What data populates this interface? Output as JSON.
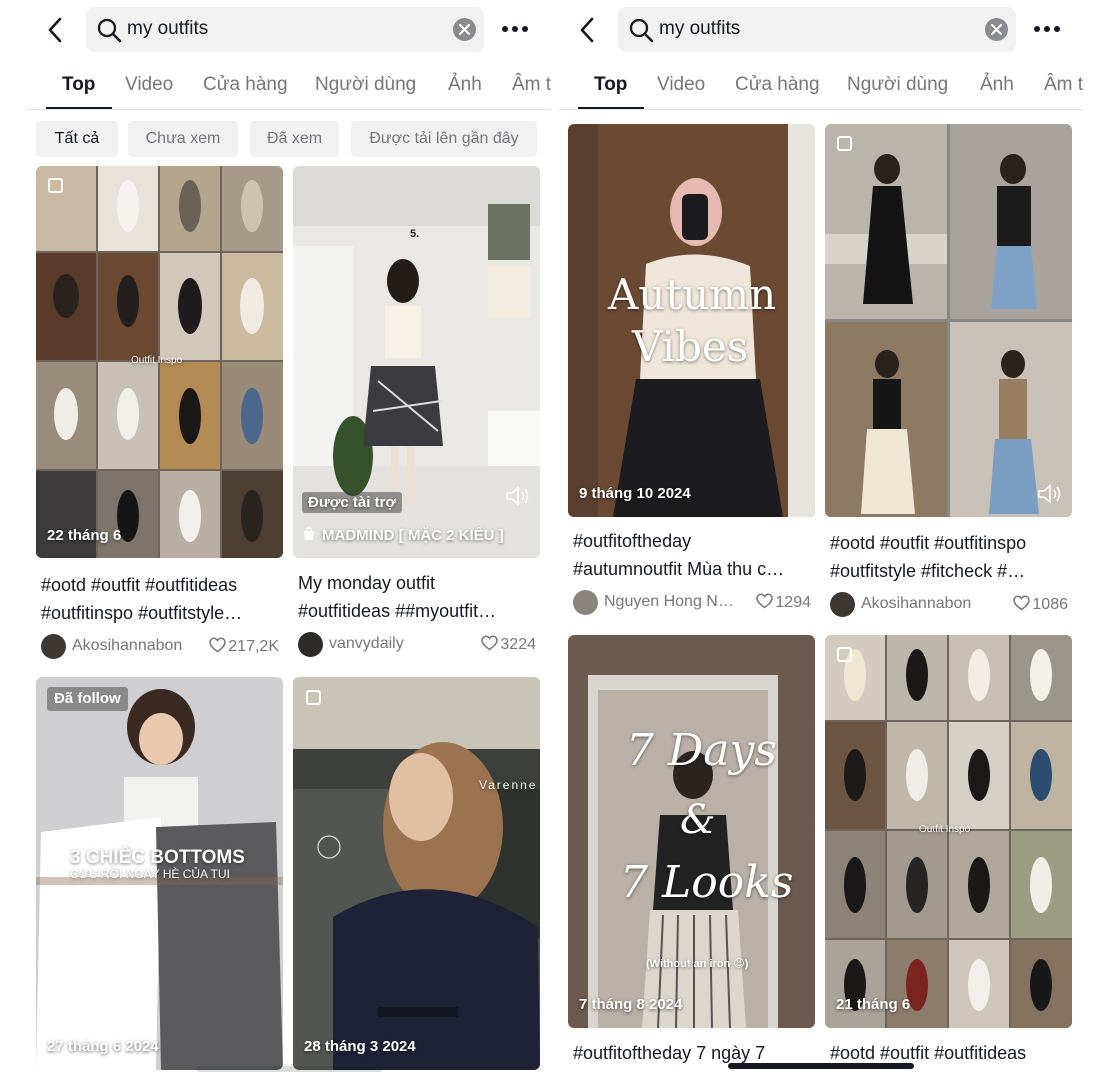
{
  "colors": {
    "text": "#161823",
    "muted": "#75767b",
    "chip_bg": "#f1f1f2"
  },
  "left": {
    "search": {
      "query": "my outfits"
    },
    "tabs": [
      "Top",
      "Video",
      "Cửa hàng",
      "Người dùng",
      "Ảnh",
      "Âm t"
    ],
    "chips": [
      "Tất cả",
      "Chưa xem",
      "Đã xem",
      "Được tải lên gần đây"
    ],
    "cards": [
      {
        "date": "22 tháng 6",
        "overlay": "Outfit Inspo",
        "caption1": "#ootd #outfit #outfitideas",
        "caption2": "#outfitinspo #outfitstyle…",
        "author": "Akosihannabon",
        "likes": "217,2K"
      },
      {
        "sponsored": "Được tài trợ",
        "ad_label": "MADMIND [ MẶC 2 KIỂU ]",
        "number": "5.",
        "caption1": "My monday outfit",
        "caption2": "#outfitideas ##myoutfit…",
        "author": "vanvydaily",
        "likes": "3224"
      },
      {
        "badge": "Đã follow",
        "date": "27 tháng 6 2024",
        "overlay1": "3 CHIẾC BOTTOMS",
        "overlay2": "CỨU RỖI NGÀY HÈ CỦA TUI"
      },
      {
        "date": "28 tháng 3 2024",
        "store_sign": "Varenne"
      }
    ]
  },
  "right": {
    "search": {
      "query": "my outfits"
    },
    "tabs": [
      "Top",
      "Video",
      "Cửa hàng",
      "Người dùng",
      "Ảnh",
      "Âm t"
    ],
    "cards": [
      {
        "date": "9 tháng 10 2024",
        "overlay1": "Autumn",
        "overlay2": "Vibes",
        "caption1": "#outfitoftheday",
        "caption2": "#autumnoutfit Mùa thu c…",
        "author": "Nguyen Hong N…",
        "likes": "1294"
      },
      {
        "caption1": "#ootd #outfit #outfitinspo",
        "caption2": "#outfitstyle #fitcheck #…",
        "author": "Akosihannabon",
        "likes": "1086"
      },
      {
        "date": "7 tháng 8 2024",
        "overlay1": "7 Days",
        "overlay2": "&",
        "overlay3": "7 Looks",
        "overlay4": "(Without an iron 😉)",
        "caption1": "#outfitoftheday 7 ngày 7"
      },
      {
        "date": "21 tháng 6",
        "overlay": "Outfit Inspo",
        "caption1": "#ootd #outfit #outfitideas"
      }
    ]
  }
}
